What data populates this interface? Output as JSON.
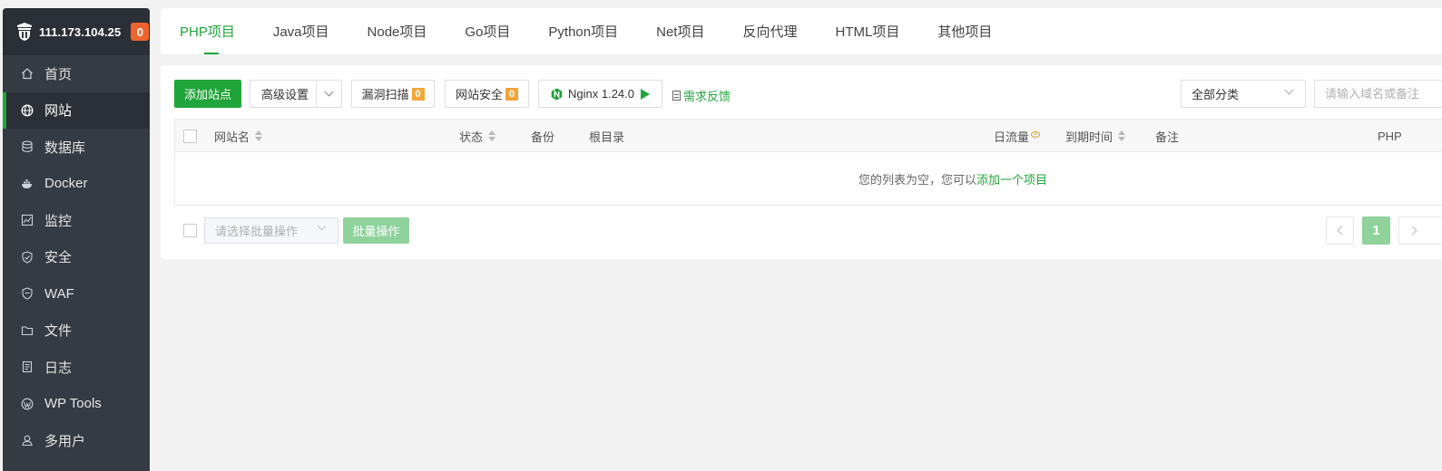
{
  "sidebar": {
    "server_ip": "111.173.104.25",
    "alert_count": "0",
    "items": [
      {
        "label": "首页",
        "icon": "home-icon"
      },
      {
        "label": "网站",
        "icon": "globe-icon"
      },
      {
        "label": "数据库",
        "icon": "database-icon"
      },
      {
        "label": "Docker",
        "icon": "docker-icon"
      },
      {
        "label": "监控",
        "icon": "monitor-icon"
      },
      {
        "label": "安全",
        "icon": "shield-icon"
      },
      {
        "label": "WAF",
        "icon": "waf-icon"
      },
      {
        "label": "文件",
        "icon": "folder-icon"
      },
      {
        "label": "日志",
        "icon": "log-icon"
      },
      {
        "label": "WP Tools",
        "icon": "wordpress-icon"
      },
      {
        "label": "多用户",
        "icon": "users-icon"
      }
    ],
    "active_index": 1
  },
  "tabs": [
    {
      "label": "PHP项目"
    },
    {
      "label": "Java项目"
    },
    {
      "label": "Node项目"
    },
    {
      "label": "Go项目"
    },
    {
      "label": "Python项目"
    },
    {
      "label": "Net项目"
    },
    {
      "label": "反向代理"
    },
    {
      "label": "HTML项目"
    },
    {
      "label": "其他项目"
    }
  ],
  "toolbar": {
    "add_site": "添加站点",
    "advanced": "高级设置",
    "vuln_scan": "漏洞扫描",
    "vuln_count": "0",
    "site_security": "网站安全",
    "security_count": "0",
    "nginx": "Nginx 1.24.0",
    "feedback": "需求反馈",
    "category": "全部分类",
    "search_placeholder": "请输入域名或备注"
  },
  "table": {
    "columns": {
      "name": "网站名",
      "status": "状态",
      "backup": "备份",
      "root": "根目录",
      "traffic": "日流量",
      "expire": "到期时间",
      "note": "备注",
      "php": "PHP"
    },
    "empty_text": "您的列表为空，您可以",
    "empty_link": "添加一个项目"
  },
  "footer": {
    "batch_placeholder": "请选择批量操作",
    "batch_button": "批量操作",
    "current_page": "1"
  },
  "colors": {
    "accent": "#20a53a",
    "sidebar_bg": "#353b42",
    "badge_orange": "#f0632d"
  }
}
